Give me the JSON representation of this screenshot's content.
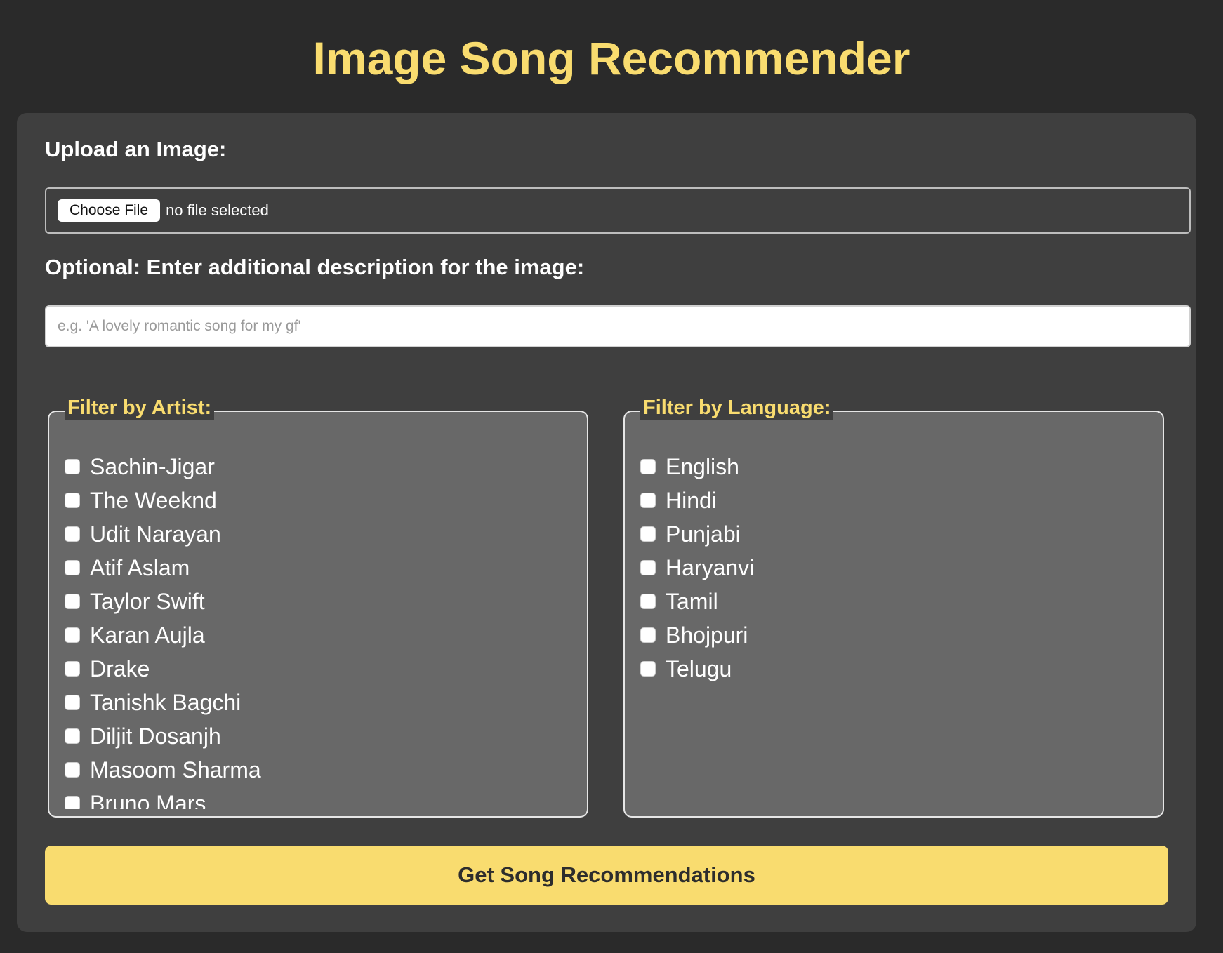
{
  "page": {
    "title": "Image Song Recommender"
  },
  "upload": {
    "label": "Upload an Image:",
    "button_label": "Choose File",
    "status": "no file selected"
  },
  "description": {
    "label": "Optional: Enter additional description for the image:",
    "value": "",
    "placeholder": "e.g. 'A lovely romantic song for my gf'"
  },
  "artist_filter": {
    "legend": "Filter by Artist:",
    "items": [
      {
        "label": "Sachin-Jigar",
        "checked": false
      },
      {
        "label": "The Weeknd",
        "checked": false
      },
      {
        "label": "Udit Narayan",
        "checked": false
      },
      {
        "label": "Atif Aslam",
        "checked": false
      },
      {
        "label": "Taylor Swift",
        "checked": false
      },
      {
        "label": "Karan Aujla",
        "checked": false
      },
      {
        "label": "Drake",
        "checked": false
      },
      {
        "label": "Tanishk Bagchi",
        "checked": false
      },
      {
        "label": "Diljit Dosanjh",
        "checked": false
      },
      {
        "label": "Masoom Sharma",
        "checked": false
      },
      {
        "label": "Bruno Mars",
        "checked": false
      }
    ]
  },
  "language_filter": {
    "legend": "Filter by Language:",
    "items": [
      {
        "label": "English",
        "checked": false
      },
      {
        "label": "Hindi",
        "checked": false
      },
      {
        "label": "Punjabi",
        "checked": false
      },
      {
        "label": "Haryanvi",
        "checked": false
      },
      {
        "label": "Tamil",
        "checked": false
      },
      {
        "label": "Bhojpuri",
        "checked": false
      },
      {
        "label": "Telugu",
        "checked": false
      }
    ]
  },
  "submit": {
    "label": "Get Song Recommendations"
  },
  "colors": {
    "background": "#2a2a2a",
    "card": "#3f3f3f",
    "panel": "#686868",
    "accent": "#f9dc6f"
  }
}
